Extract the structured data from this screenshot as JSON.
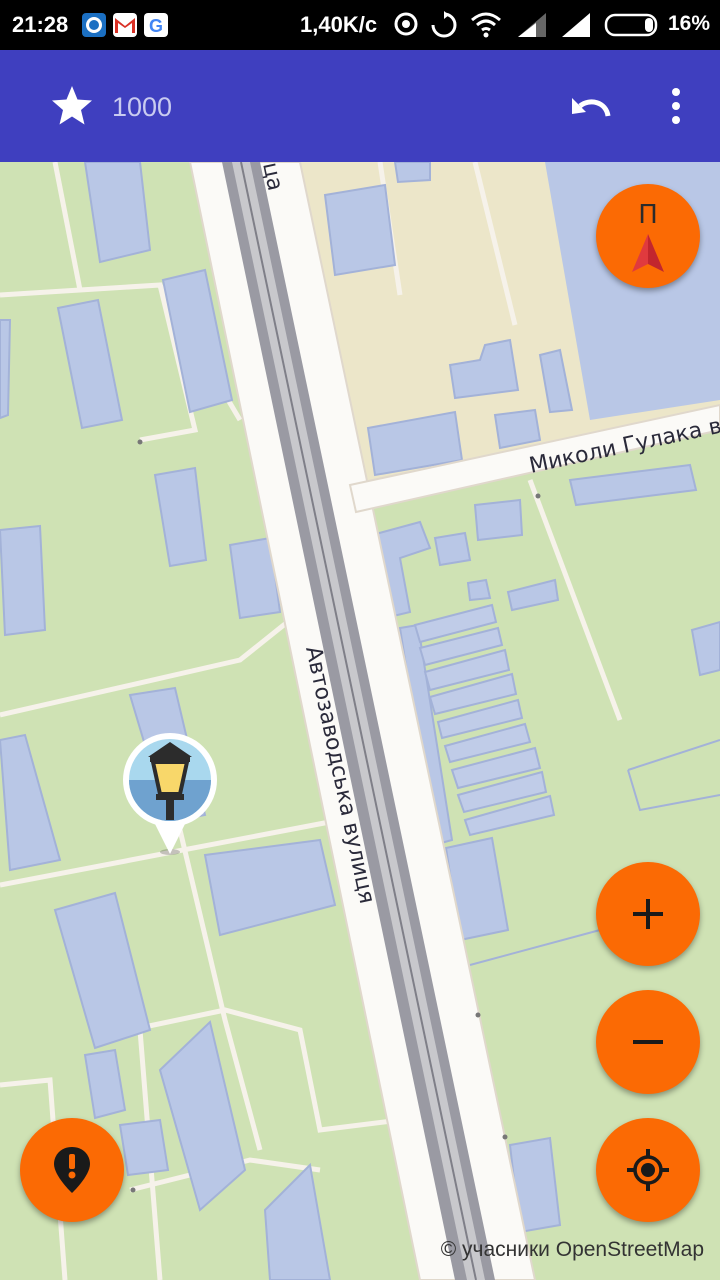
{
  "status_bar": {
    "time": "21:28",
    "speed": "1,40K/c",
    "battery_percent": "16%",
    "notification_icons": [
      "app-icon",
      "gmail-icon",
      "google-icon"
    ],
    "system_icons": [
      "hotspot-icon",
      "sync-icon",
      "wifi-icon",
      "signal-icon",
      "signal-icon",
      "battery-icon"
    ]
  },
  "app_bar": {
    "star_count": "1000",
    "color": "#3f3fbf"
  },
  "map": {
    "streets": {
      "avtozavodska": "Автозаводська вулиця",
      "hulaka": "Миколи Гулака ву",
      "top_partial": "ица"
    },
    "marker_icon": "street-lamp-icon"
  },
  "controls": {
    "compass_label": "П",
    "zoom_in_icon": "plus-icon",
    "zoom_out_icon": "minus-icon",
    "locate_icon": "my-location-icon",
    "report_icon": "alert-marker-icon",
    "accent_color": "#fb6a04"
  },
  "attribution": "© учасники OpenStreetMap"
}
